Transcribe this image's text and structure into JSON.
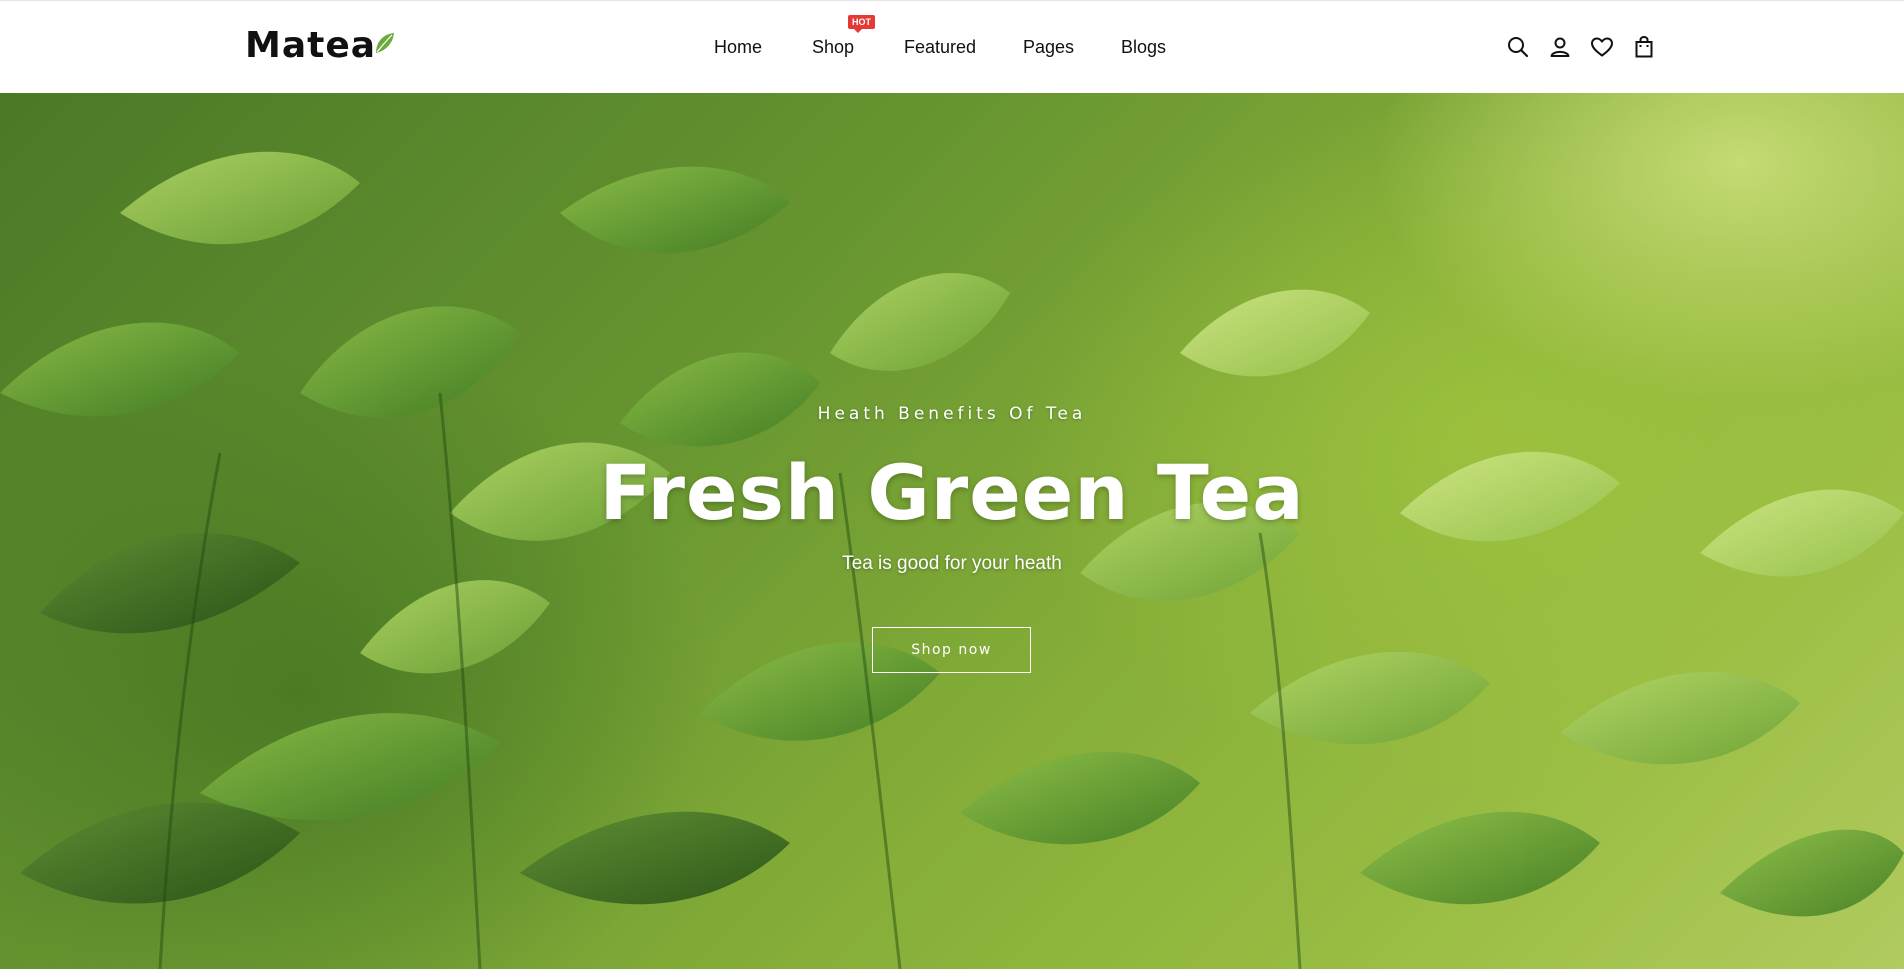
{
  "brand": {
    "name": "Matea",
    "leaf_color": "#6bab3e"
  },
  "nav": {
    "home": "Home",
    "shop": "Shop",
    "shop_badge": "HOT",
    "featured": "Featured",
    "pages": "Pages",
    "blogs": "Blogs"
  },
  "header_icons": [
    "search-icon",
    "user-icon",
    "heart-icon",
    "shopping-bag-icon"
  ],
  "hero": {
    "kicker": "Heath Benefits Of Tea",
    "title": "Fresh Green Tea",
    "subtitle": "Tea is good for your heath",
    "cta": "Shop now"
  },
  "colors": {
    "badge": "#e53935",
    "text": "#111111",
    "hero_text": "#ffffff"
  }
}
